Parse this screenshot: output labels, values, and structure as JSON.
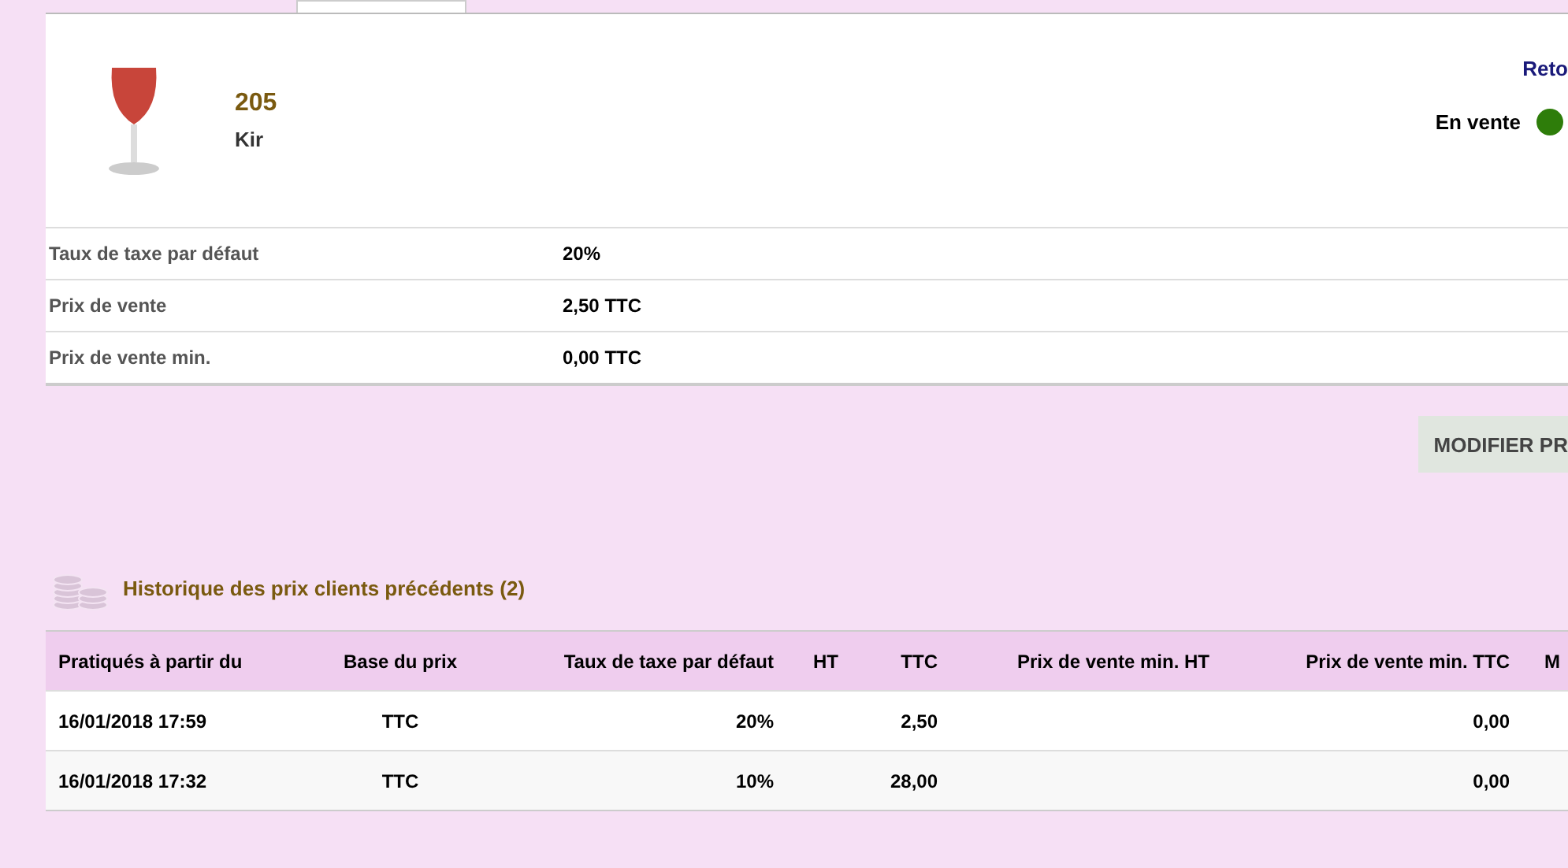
{
  "tabs": [
    {
      "selected": true
    }
  ],
  "product": {
    "ref": "205",
    "name": "Kir",
    "back_link": "Reto",
    "status": {
      "label": "En vente",
      "on": true
    }
  },
  "fields": [
    {
      "label": "Taux de taxe par défaut",
      "value": "20%"
    },
    {
      "label": "Prix de vente",
      "value": "2,50 TTC"
    },
    {
      "label": "Prix de vente min.",
      "value": "0,00 TTC"
    }
  ],
  "buttons": [
    {
      "label": "MODIFIER PR"
    }
  ],
  "history": {
    "title": "Historique des prix clients précédents (2)",
    "columns": [
      "Pratiqués à partir du",
      "Base du prix",
      "Taux de taxe par défaut",
      "HT",
      "TTC",
      "Prix de vente min. HT",
      "Prix de vente min. TTC",
      "M"
    ],
    "rows": [
      [
        "16/01/2018 17:59",
        "TTC",
        "20%",
        "",
        "2,50",
        "",
        "0,00",
        ""
      ],
      [
        "16/01/2018 17:32",
        "TTC",
        "10%",
        "",
        "28,00",
        "",
        "0,00",
        ""
      ]
    ]
  }
}
